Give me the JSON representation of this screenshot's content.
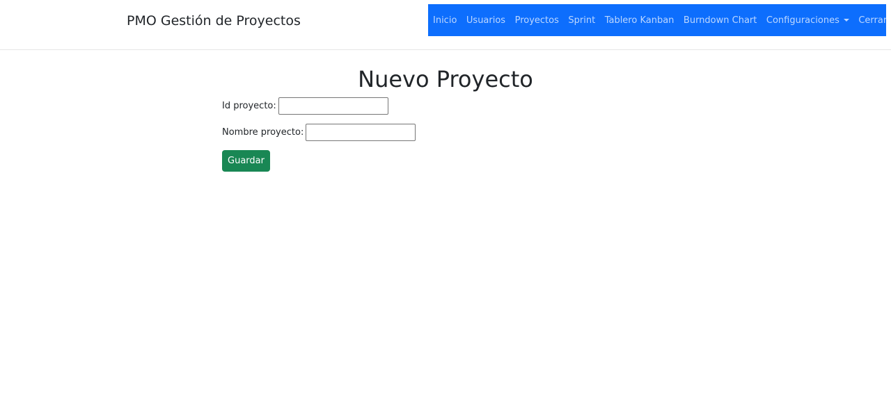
{
  "header": {
    "brand": "PMO Gestión de Proyectos",
    "nav": [
      {
        "label": "Inicio"
      },
      {
        "label": "Usuarios"
      },
      {
        "label": "Proyectos"
      },
      {
        "label": "Sprint"
      },
      {
        "label": "Tablero Kanban"
      },
      {
        "label": "Burndown Chart"
      },
      {
        "label": "Configuraciones"
      },
      {
        "label": "Cerrar Sesion"
      }
    ],
    "nav_color": "#0d6efd"
  },
  "main": {
    "title": "Nuevo Proyecto",
    "fields": [
      {
        "label": "Id proyecto:",
        "value": ""
      },
      {
        "label": "Nombre proyecto:",
        "value": ""
      }
    ],
    "save_label": "Guardar",
    "save_color": "#198754"
  }
}
